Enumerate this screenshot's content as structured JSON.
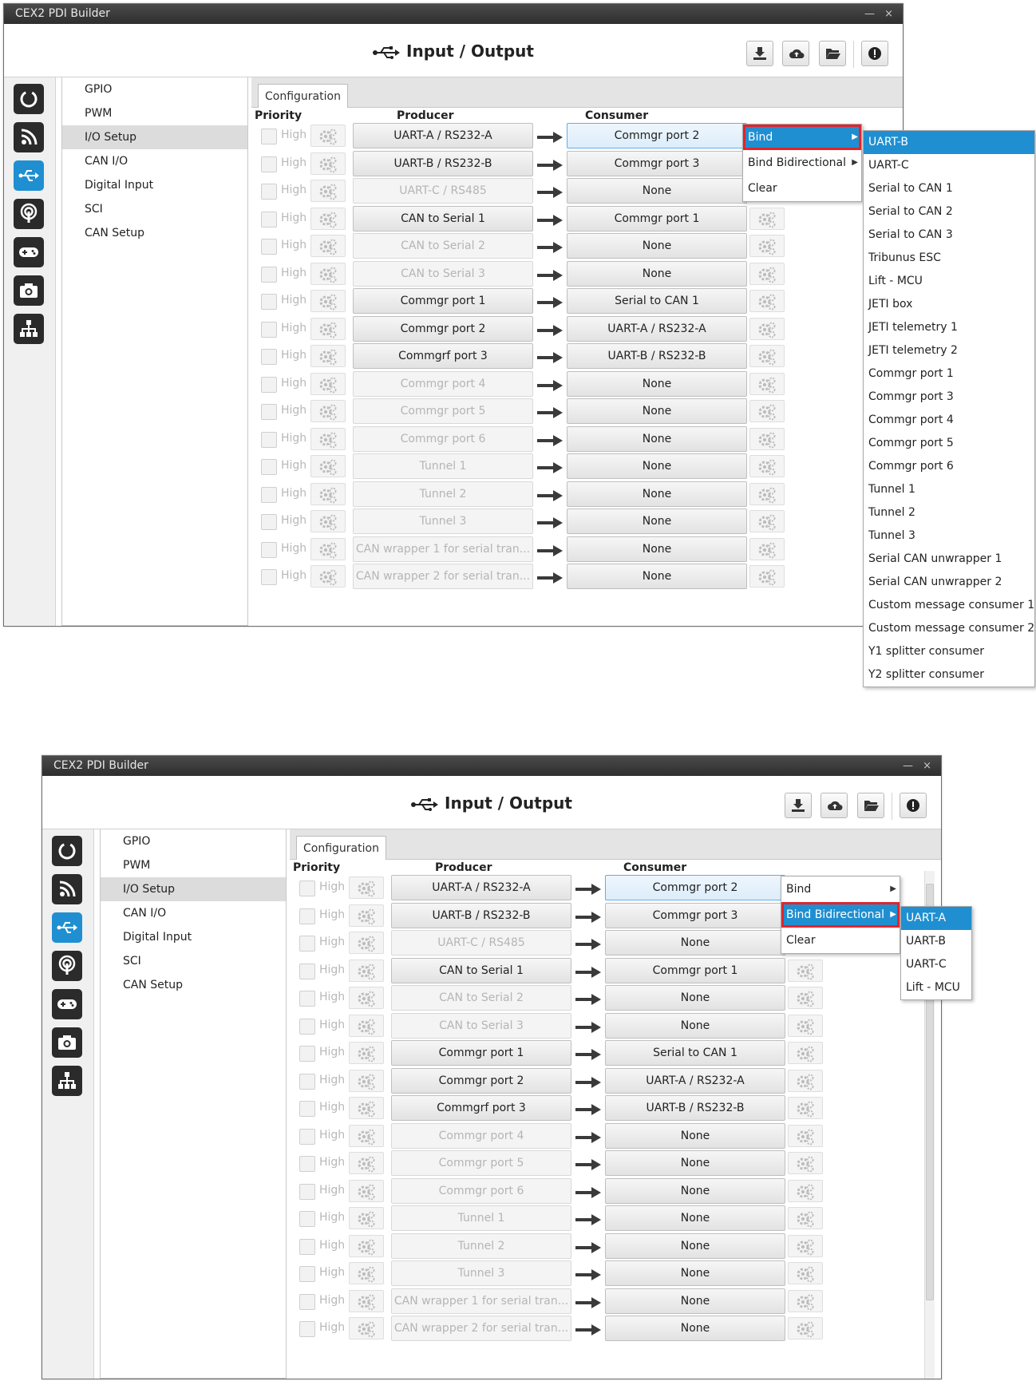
{
  "window": {
    "title": "CEX2 PDI Builder",
    "controls": "— ×"
  },
  "header": {
    "title": "Input / Output",
    "title_icon": "usb-icon",
    "toolbar_icons": [
      "download-icon",
      "cloud-upload-icon",
      "folder-open-icon",
      "info-icon"
    ]
  },
  "sidebar_icons": [
    "power-icon",
    "rss-feed-icon",
    "usb-icon",
    "antenna-icon",
    "gamepad-icon",
    "camera-icon",
    "network-icon"
  ],
  "nav": {
    "items": [
      "GPIO",
      "PWM",
      "I/O Setup",
      "CAN I/O",
      "Digital Input",
      "SCI",
      "CAN Setup"
    ],
    "active": "I/O Setup"
  },
  "tab": {
    "label": "Configuration"
  },
  "columns": {
    "priority": "Priority",
    "producer": "Producer",
    "consumer": "Consumer"
  },
  "priority_label": "High",
  "rows": [
    {
      "producer": "UART-A / RS232-A",
      "consumer": "Commgr port 2",
      "producer_enabled": true,
      "selected": true
    },
    {
      "producer": "UART-B / RS232-B",
      "consumer": "Commgr port 3",
      "producer_enabled": true
    },
    {
      "producer": "UART-C / RS485",
      "consumer": "None",
      "producer_enabled": false
    },
    {
      "producer": "CAN to Serial 1",
      "consumer": "Commgr port 1",
      "producer_enabled": true
    },
    {
      "producer": "CAN to Serial 2",
      "consumer": "None",
      "producer_enabled": false
    },
    {
      "producer": "CAN to Serial 3",
      "consumer": "None",
      "producer_enabled": false
    },
    {
      "producer": "Commgr port 1",
      "consumer": "Serial to CAN 1",
      "producer_enabled": true
    },
    {
      "producer": "Commgr port 2",
      "consumer": "UART-A / RS232-A",
      "producer_enabled": true
    },
    {
      "producer": "Commgrf port 3",
      "consumer": "UART-B / RS232-B",
      "producer_enabled": true
    },
    {
      "producer": "Commgr port 4",
      "consumer": "None",
      "producer_enabled": false
    },
    {
      "producer": "Commgr port 5",
      "consumer": "None",
      "producer_enabled": false
    },
    {
      "producer": "Commgr port 6",
      "consumer": "None",
      "producer_enabled": false
    },
    {
      "producer": "Tunnel 1",
      "consumer": "None",
      "producer_enabled": false
    },
    {
      "producer": "Tunnel 2",
      "consumer": "None",
      "producer_enabled": false
    },
    {
      "producer": "Tunnel 3",
      "consumer": "None",
      "producer_enabled": false
    },
    {
      "producer": "CAN wrapper 1 for serial tran...",
      "consumer": "None",
      "producer_enabled": false
    },
    {
      "producer": "CAN wrapper 2 for serial tran...",
      "consumer": "None",
      "producer_enabled": false
    }
  ],
  "context_menu": {
    "items": [
      "Bind",
      "Bind Bidirectional",
      "Clear"
    ]
  },
  "bind_submenu": [
    "UART-B",
    "UART-C",
    "Serial to CAN 1",
    "Serial to CAN 2",
    "Serial to CAN 3",
    "Tribunus ESC",
    "Lift - MCU",
    "JETI box",
    "JETI telemetry 1",
    "JETI telemetry 2",
    "Commgr port 1",
    "Commgr port 3",
    "Commgr port 4",
    "Commgr port 5",
    "Commgr port 6",
    "Tunnel 1",
    "Tunnel 2",
    "Tunnel 3",
    "Serial CAN unwrapper 1",
    "Serial CAN unwrapper 2",
    "Custom message consumer 1",
    "Custom message consumer 2",
    "Y1 splitter consumer",
    "Y2 splitter consumer"
  ],
  "bidir_submenu": [
    "UART-A",
    "UART-B",
    "UART-C",
    "Lift - MCU"
  ],
  "colors": {
    "accent": "#1f8fd1",
    "highlight_box": "#e3242b",
    "titlebar": "#3a3a3a"
  }
}
